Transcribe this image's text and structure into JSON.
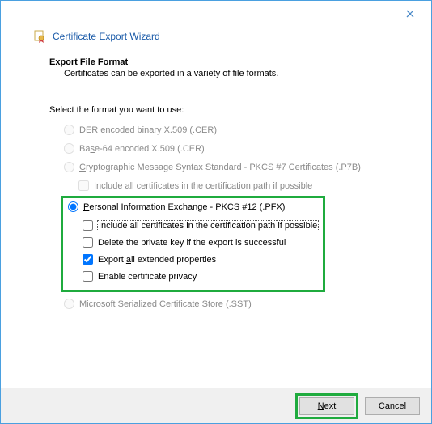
{
  "window": {
    "title": "Certificate Export Wizard"
  },
  "section": {
    "title": "Export File Format",
    "description": "Certificates can be exported in a variety of file formats."
  },
  "prompt": "Select the format you want to use:",
  "options": {
    "der": {
      "label_pre": "",
      "label_u": "D",
      "label_post": "ER encoded binary X.509 (.CER)"
    },
    "base64": {
      "label_pre": "Ba",
      "label_u": "s",
      "label_post": "e-64 encoded X.509 (.CER)"
    },
    "pkcs7": {
      "label_pre": "",
      "label_u": "C",
      "label_post": "ryptographic Message Syntax Standard - PKCS #7 Certificates (.P7B)"
    },
    "pkcs7_sub": {
      "label": "Include all certificates in the certification path if possible"
    },
    "pfx": {
      "label_pre": "",
      "label_u": "P",
      "label_post": "ersonal Information Exchange - PKCS #12 (.PFX)"
    },
    "pfx_sub1": {
      "label": "Include all certificates in the certification path if possible"
    },
    "pfx_sub2": {
      "label": "Delete the private key if the export is successful"
    },
    "pfx_sub3": {
      "label_pre": "Export ",
      "label_u": "a",
      "label_post": "ll extended properties"
    },
    "pfx_sub4": {
      "label": "Enable certificate privacy"
    },
    "sst": {
      "label": "Microsoft Serialized Certificate Store (.SST)"
    }
  },
  "buttons": {
    "next_pre": "",
    "next_u": "N",
    "next_post": "ext",
    "cancel": "Cancel"
  }
}
